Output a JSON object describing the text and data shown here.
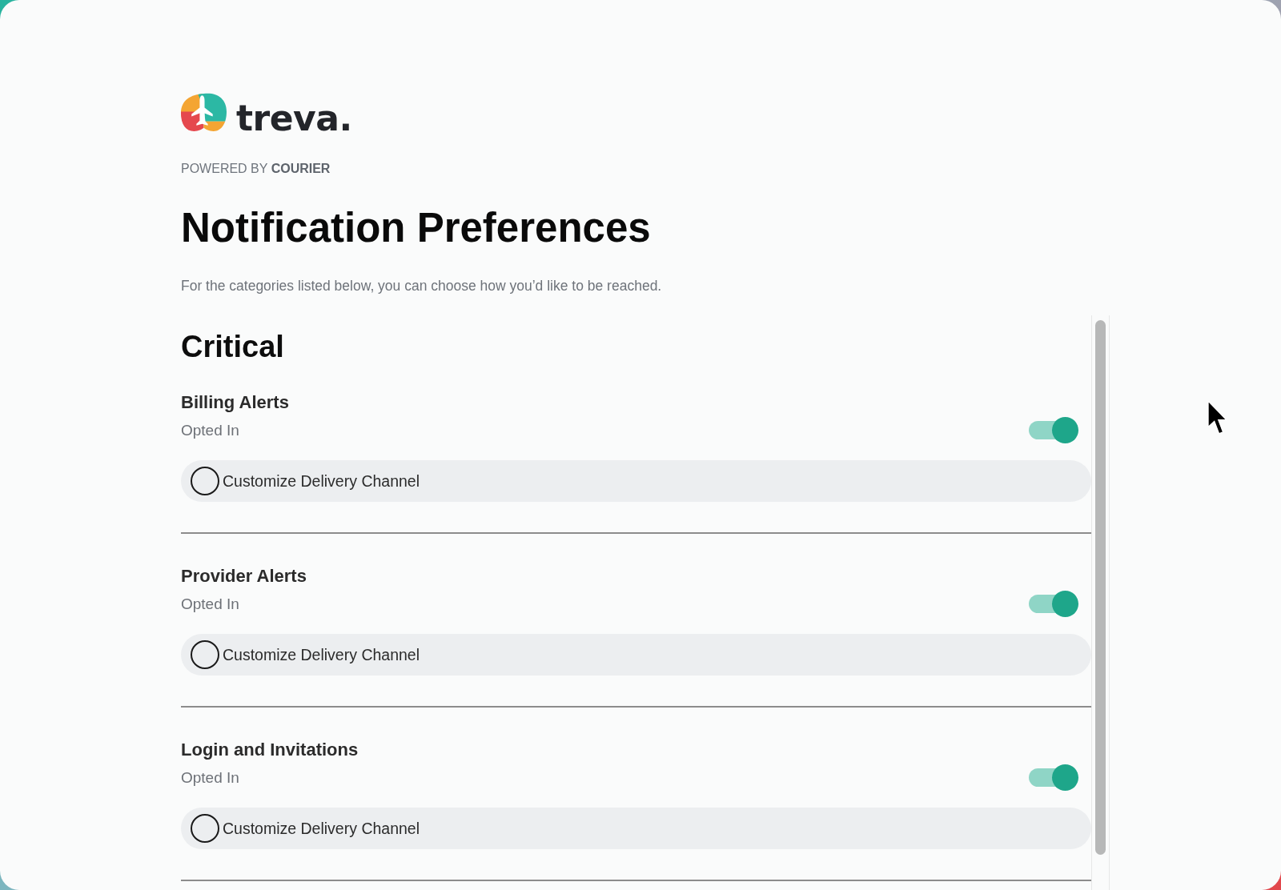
{
  "brand": {
    "name": "treva.",
    "powered_by": "POWERED BY **COURIER**"
  },
  "title": "Notification Preferences",
  "subtitle": "For the categories listed below, you can choose how you’d like to be reached.",
  "sections": [
    {
      "title": "Critical",
      "items": [
        {
          "name": "Billing Alerts",
          "status": "Opted In",
          "on": true,
          "customize": {
            "label": "Customize Delivery Channel",
            "checked": false
          }
        },
        {
          "name": "Provider Alerts",
          "status": "Opted In",
          "on": true,
          "customize": {
            "label": "Customize Delivery Channel",
            "checked": false
          }
        },
        {
          "name": "Login and Invitations",
          "status": "Opted In",
          "on": true,
          "customize": {
            "label": "Customize Delivery Channel",
            "checked": false
          }
        }
      ]
    }
  ]
}
